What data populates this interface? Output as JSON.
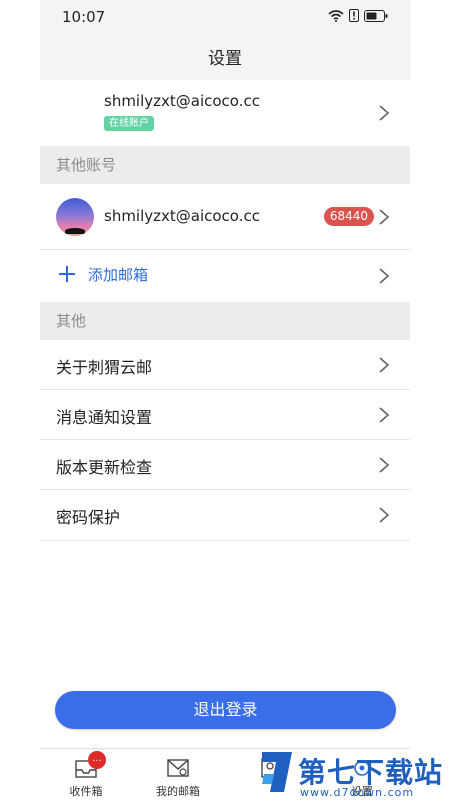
{
  "status_bar": {
    "time": "10:07"
  },
  "header": {
    "title": "设置"
  },
  "current_account": {
    "email": "shmilyzxt@aicoco.cc",
    "badge": "在线账户"
  },
  "other_accounts": {
    "section_label": "其他账号",
    "items": [
      {
        "email": "shmilyzxt@aicoco.cc",
        "unread_count": "68440"
      }
    ],
    "add_label": "添加邮箱"
  },
  "other": {
    "section_label": "其他",
    "items": [
      {
        "label": "关于刺猬云邮"
      },
      {
        "label": "消息通知设置"
      },
      {
        "label": "版本更新检查"
      },
      {
        "label": "密码保护"
      }
    ]
  },
  "logout_label": "退出登录",
  "tabbar": {
    "tabs": [
      {
        "label": "收件箱",
        "icon": "inbox-icon",
        "badge": "..."
      },
      {
        "label": "我的邮箱",
        "icon": "mailbox-icon"
      },
      {
        "label": "",
        "icon": "contacts-icon"
      },
      {
        "label": "设置",
        "icon": "settings-icon"
      }
    ]
  },
  "watermark": {
    "text": "第七下载站",
    "url": "www.d7down.com"
  },
  "colors": {
    "accent": "#3a6ee8",
    "badge_green": "#64d2a5",
    "badge_red": "#d9534f",
    "section_bg": "#ececec"
  }
}
